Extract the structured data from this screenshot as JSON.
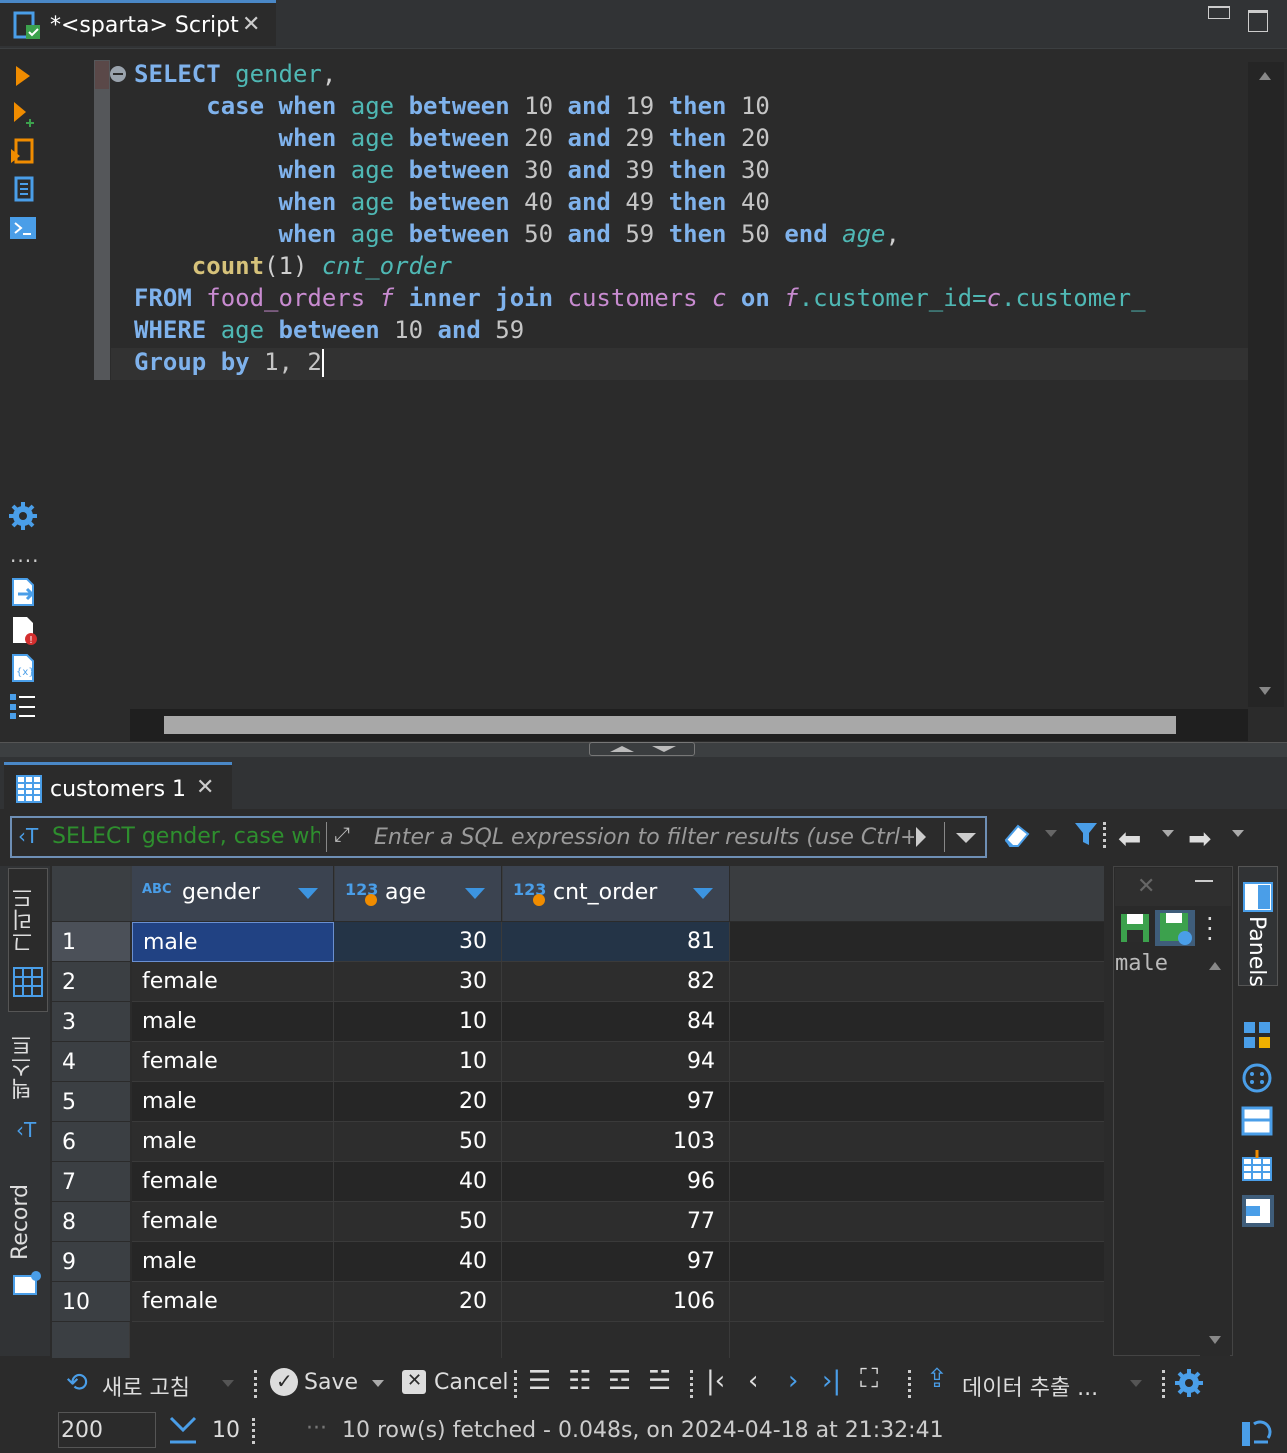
{
  "editor_tab": {
    "label": "*<sparta> Script"
  },
  "code": {
    "l1": {
      "k": "SELECT",
      "c": "gender",
      "p": ","
    },
    "case_kw": "case",
    "when": "when",
    "age": "age",
    "between": "between",
    "and": "and",
    "then": "then",
    "ranges": [
      {
        "lo": "10",
        "hi": "19",
        "v": "10"
      },
      {
        "lo": "20",
        "hi": "29",
        "v": "20"
      },
      {
        "lo": "30",
        "hi": "39",
        "v": "30"
      },
      {
        "lo": "40",
        "hi": "49",
        "v": "40"
      },
      {
        "lo": "50",
        "hi": "59",
        "v": "50"
      }
    ],
    "end": "end",
    "age_alias": "age",
    "comma": ",",
    "count": "count",
    "count_arg": "(1)",
    "cnt_alias": "cnt_order",
    "from": "FROM",
    "t1": "food_orders",
    "a1": "f",
    "inner": "inner",
    "join": "join",
    "t2": "customers",
    "a2": "c",
    "on": "on",
    "cond_a1": "f",
    "cond_c1": ".customer_id=",
    "cond_a2": "c",
    "cond_c2": ".customer_",
    "where": "WHERE",
    "w_col": "age",
    "w_between": "between",
    "w_lo": "10",
    "w_and": "and",
    "w_hi": "59",
    "group": "Group",
    "by": "by",
    "group_args": "1, 2"
  },
  "results_tab": {
    "label": "customers 1"
  },
  "filter": {
    "sql_preview": "SELECT gender, case whe",
    "placeholder": "Enter a SQL expression to filter results (use Ctrl+Space)"
  },
  "vtabs": {
    "grid": "그리드",
    "text": "텍스트",
    "record": "Record"
  },
  "grid": {
    "columns": [
      {
        "type": "ABC",
        "name": "gender"
      },
      {
        "type": "123",
        "name": "age"
      },
      {
        "type": "123",
        "name": "cnt_order"
      }
    ],
    "rows": [
      {
        "n": "1",
        "gender": "male",
        "age": "30",
        "cnt": "81"
      },
      {
        "n": "2",
        "gender": "female",
        "age": "30",
        "cnt": "82"
      },
      {
        "n": "3",
        "gender": "male",
        "age": "10",
        "cnt": "84"
      },
      {
        "n": "4",
        "gender": "female",
        "age": "10",
        "cnt": "94"
      },
      {
        "n": "5",
        "gender": "male",
        "age": "20",
        "cnt": "97"
      },
      {
        "n": "6",
        "gender": "male",
        "age": "50",
        "cnt": "103"
      },
      {
        "n": "7",
        "gender": "female",
        "age": "40",
        "cnt": "96"
      },
      {
        "n": "8",
        "gender": "female",
        "age": "50",
        "cnt": "77"
      },
      {
        "n": "9",
        "gender": "male",
        "age": "40",
        "cnt": "97"
      },
      {
        "n": "10",
        "gender": "female",
        "age": "20",
        "cnt": "106"
      }
    ]
  },
  "panel": {
    "value": "male",
    "label": "Panels"
  },
  "toolbar": {
    "refresh": "새로 고침",
    "save": "Save",
    "cancel": "Cancel",
    "export": "데이터 추출 ..."
  },
  "status": {
    "max_rows": "200",
    "fetch_count": "10",
    "message": "10 row(s) fetched - 0.048s, on 2024-04-18 at 21:32:41"
  },
  "colors": {
    "accent": "#4a88c7",
    "selected_cell": "#214283",
    "header": "#3b4350"
  }
}
